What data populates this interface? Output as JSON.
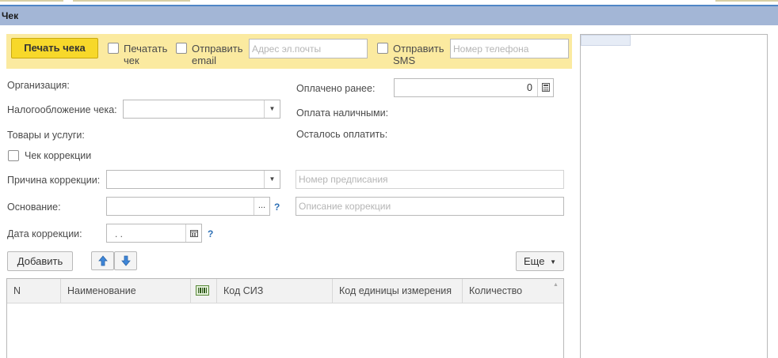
{
  "window": {
    "title": "Чек"
  },
  "toolbar": {
    "print_button": "Печать чека",
    "print_check_label": "Печатать чек",
    "send_email_label": "Отправить email",
    "email_placeholder": "Адрес эл.почты",
    "send_sms_label": "Отправить SMS",
    "phone_placeholder": "Номер телефона"
  },
  "form": {
    "organization_label": "Организация:",
    "taxation_label": "Налогообложение чека:",
    "goods_label": "Товары и услуги:",
    "correction_check_label": "Чек коррекции",
    "correction_reason_label": "Причина коррекции:",
    "basis_label": "Основание:",
    "correction_date_label": "Дата коррекции:",
    "correction_date_value": " .  .",
    "paid_earlier_label": "Оплачено ранее:",
    "paid_earlier_value": "0",
    "cash_payment_label": "Оплата наличными:",
    "remaining_label": "Осталось оплатить:",
    "order_number_placeholder": "Номер предписания",
    "correction_description_placeholder": "Описание коррекции",
    "help_mark": "?",
    "ellipsis": "..."
  },
  "actions": {
    "add_button": "Добавить",
    "more_button": "Еще"
  },
  "table": {
    "columns": [
      "N",
      "Наименование",
      "",
      "Код СИЗ",
      "Код единицы измерения",
      "Количество"
    ],
    "rows": []
  },
  "colors": {
    "title_bar": "#a3b6d6",
    "toolbar_bg": "#fbeaa0",
    "primary_button": "#f7d82a",
    "help_accent": "#2c6fb5"
  }
}
